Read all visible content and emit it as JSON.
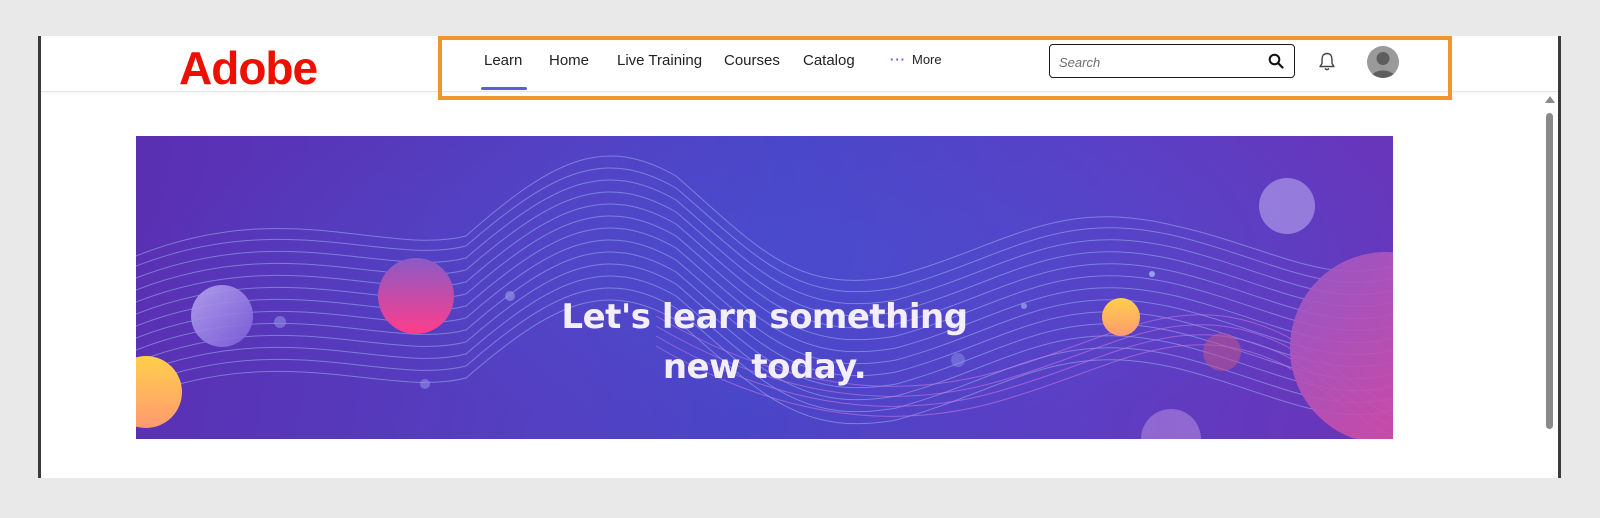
{
  "brand": {
    "logo_text": "Adobe",
    "color": "#eb1000"
  },
  "nav": {
    "items": [
      {
        "label": "Learn",
        "active": true
      },
      {
        "label": "Home",
        "active": false
      },
      {
        "label": "Live Training",
        "active": false
      },
      {
        "label": "Courses",
        "active": false
      },
      {
        "label": "Catalog",
        "active": false
      }
    ],
    "more_label": "More",
    "more_icon": "ellipsis-icon",
    "accent": "#5c5ce0"
  },
  "search": {
    "placeholder": "Search",
    "value": "",
    "icon": "search-icon"
  },
  "header_icons": {
    "notifications": "bell-icon",
    "avatar": "user-avatar"
  },
  "highlight_color": "#f0962c",
  "banner": {
    "line1": "Let's learn something",
    "line2": "new today."
  }
}
